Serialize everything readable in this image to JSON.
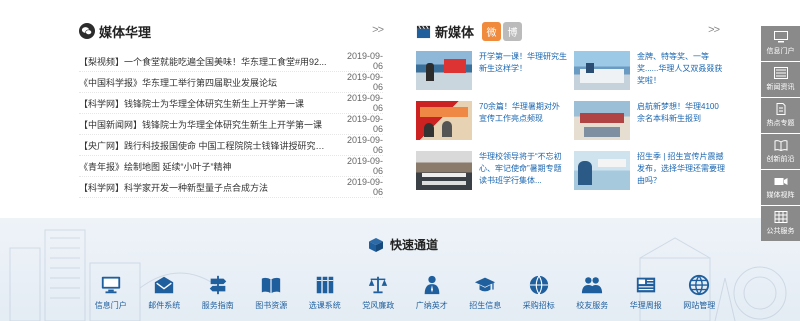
{
  "media": {
    "title": "媒体华理",
    "more": ">>",
    "items": [
      {
        "title": "【梨视频】一个食堂就能吃遍全国美味！华东理工食堂#用92...",
        "date": "2019-09-06"
      },
      {
        "title": "《中国科学报》华东理工举行第四届职业发展论坛",
        "date": "2019-09-06"
      },
      {
        "title": "【科学网】钱锋院士为华理全体研究生新生上开学第一课",
        "date": "2019-09-06"
      },
      {
        "title": "【中国新闻网】钱锋院士为华理全体研究生新生上开学第一课",
        "date": "2019-09-06"
      },
      {
        "title": "【央广网】践行科技报国使命 中国工程院院士钱锋讲授研究生...",
        "date": "2019-09-06"
      },
      {
        "title": "《青年报》绘制地图 延续“小叶子”精神",
        "date": "2019-09-06"
      },
      {
        "title": "【科学网】科学家开发一种新型量子点合成方法",
        "date": "2019-09-06"
      }
    ]
  },
  "newmedia": {
    "title": "新媒体",
    "more": ">>",
    "social": {
      "wechat": "微",
      "weibo": "博"
    },
    "cards": [
      {
        "text": "开学第一课！华理研究生新生这样学！"
      },
      {
        "text": "金牌、特等奖、一等奖......华理人又双叒叕获奖啦！"
      },
      {
        "text": "70余篇！华理暑期对外宣传工作亮点频现"
      },
      {
        "text": "启航新梦想！华理4100余名本科新生报到"
      },
      {
        "text": "华理校领导将于“不忘初心、牢记使命”暑期专题读书班学行集体..."
      },
      {
        "text": "招生季 | 招生宣传片震撼发布，选择华理还需要理由吗？"
      }
    ]
  },
  "quick": {
    "title": "快速通道",
    "links": [
      {
        "label": "信息门户",
        "icon": "monitor-icon"
      },
      {
        "label": "邮件系统",
        "icon": "mail-icon"
      },
      {
        "label": "服务指南",
        "icon": "signpost-icon"
      },
      {
        "label": "图书资源",
        "icon": "book-icon"
      },
      {
        "label": "选课系统",
        "icon": "books-icon"
      },
      {
        "label": "党风廉政",
        "icon": "scales-icon"
      },
      {
        "label": "广纳英才",
        "icon": "person-icon"
      },
      {
        "label": "招生信息",
        "icon": "graduation-cap-icon"
      },
      {
        "label": "采购招标",
        "icon": "globe-icon"
      },
      {
        "label": "校友服务",
        "icon": "people-icon"
      },
      {
        "label": "华理周报",
        "icon": "newspaper-icon"
      },
      {
        "label": "网站管理",
        "icon": "web-icon"
      }
    ]
  },
  "sidebar": {
    "items": [
      {
        "label": "信息门户",
        "icon": "monitor-icon"
      },
      {
        "label": "新闻资讯",
        "icon": "news-icon"
      },
      {
        "label": "热点专题",
        "icon": "document-icon"
      },
      {
        "label": "创新前沿",
        "icon": "book-icon"
      },
      {
        "label": "媒体视阵",
        "icon": "video-icon"
      },
      {
        "label": "公共服务",
        "icon": "grid-icon"
      }
    ]
  },
  "colors": {
    "accent": "#1f5f9e",
    "link": "#1a66b0",
    "sidebar": "#8a8a8a"
  }
}
